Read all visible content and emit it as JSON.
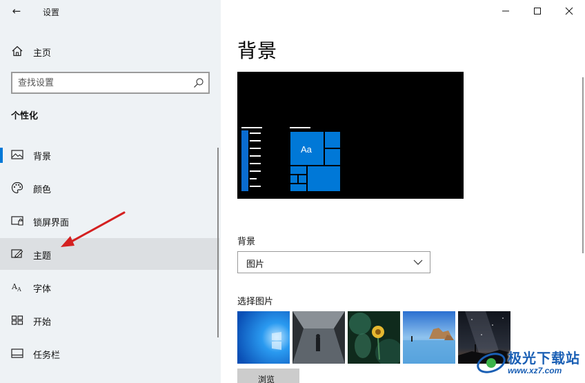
{
  "app": {
    "title": "设置",
    "back_icon": "back-arrow-icon"
  },
  "sidebar": {
    "home_label": "主页",
    "search": {
      "placeholder": "查找设置"
    },
    "section_title": "个性化",
    "items": [
      {
        "label": "背景",
        "icon": "picture-icon",
        "selected": true
      },
      {
        "label": "颜色",
        "icon": "palette-icon"
      },
      {
        "label": "锁屏界面",
        "icon": "lock-screen-icon"
      },
      {
        "label": "主题",
        "icon": "theme-brush-icon",
        "hover": true
      },
      {
        "label": "字体",
        "icon": "font-icon"
      },
      {
        "label": "开始",
        "icon": "start-icon"
      },
      {
        "label": "任务栏",
        "icon": "taskbar-icon"
      }
    ]
  },
  "window_controls": [
    "minimize-icon",
    "maximize-icon",
    "close-icon"
  ],
  "main": {
    "page_title": "背景",
    "preview_sample_text": "Aa",
    "background_label": "背景",
    "background_value": "图片",
    "choose_picture_label": "选择图片",
    "browse_label": "浏览"
  },
  "watermark": {
    "name": "极光下载站",
    "url": "www.xz7.com"
  },
  "colors": {
    "accent": "#0078d7",
    "sidebar_bg": "#eef2f5",
    "hover_bg": "#dcdfe2",
    "annotation_arrow": "#d42020"
  }
}
